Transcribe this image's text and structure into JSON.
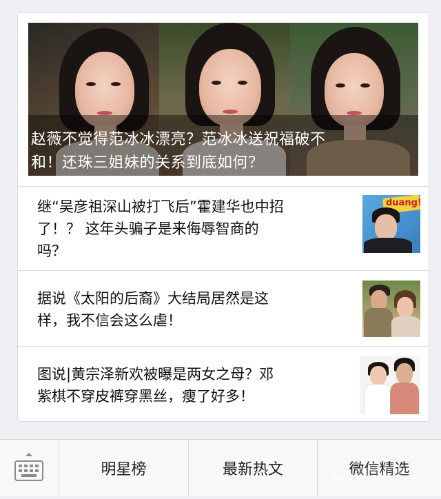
{
  "hero": {
    "title_line1": "赵薇不觉得范冰冰漂亮？范冰冰送祝福破不",
    "title_line2": "和！还珠三姐妹的关系到底如何？"
  },
  "articles": [
    {
      "line1": "继“吴彦祖深山被打飞后”霍建华也中招",
      "line2": "了！？ 这年头骗子是来侮辱智商的",
      "line3": "吗？",
      "thumb_text": "duang!"
    },
    {
      "line1": "据说《太阳的后裔》大结局居然是这",
      "line2": "样，我不信会这么虐！"
    },
    {
      "line1": "图说|黄宗泽新欢被曝是两女之母？邓",
      "line2": "紫棋不穿皮裤穿黑丝，瘦了好多！"
    }
  ],
  "bottom_menu": {
    "item1": "明星榜",
    "item2": "最新热文",
    "item3": "微信精选"
  },
  "colors": {
    "accent": "#111111",
    "background": "#efeff4"
  }
}
